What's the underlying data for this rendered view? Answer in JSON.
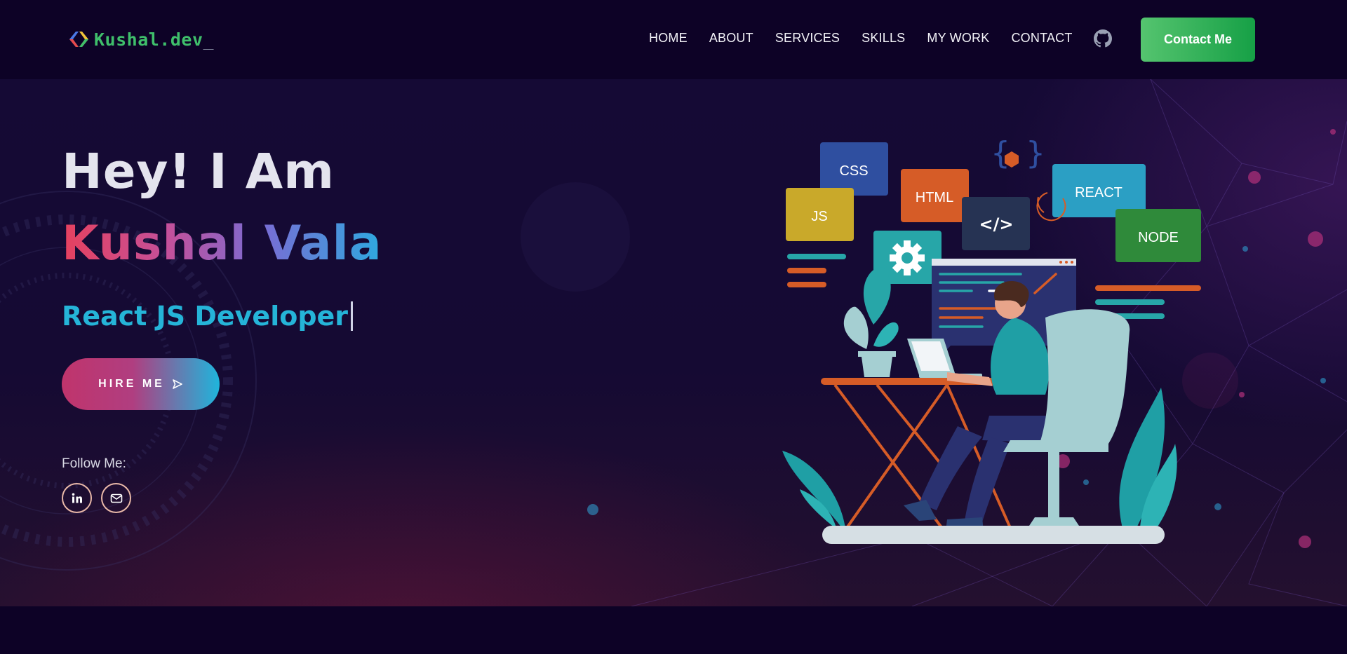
{
  "brand": {
    "name": "Kushal.dev",
    "cursor": "_"
  },
  "nav": {
    "links": [
      "HOME",
      "ABOUT",
      "SERVICES",
      "SKILLS",
      "MY WORK",
      "CONTACT"
    ],
    "contact_label": "Contact Me",
    "github_icon": "github-icon"
  },
  "hero": {
    "greeting": "Hey! I Am",
    "name": "Kushal Vala",
    "role": "React JS Developer",
    "hire_label": "HIRE ME",
    "follow_label": "Follow Me:",
    "social_icons": [
      "linkedin-icon",
      "mail-icon"
    ]
  },
  "illustration": {
    "tags": {
      "css": "CSS",
      "html": "HTML",
      "js": "JS",
      "react": "REACT",
      "node": "NODE",
      "code": "</>"
    }
  },
  "colors": {
    "background": "#0d0226",
    "brand_green": "#3fbf6b",
    "accent_cyan": "#25b4d8",
    "accent_pink": "#c0346c",
    "contact_green": "#16a046"
  }
}
